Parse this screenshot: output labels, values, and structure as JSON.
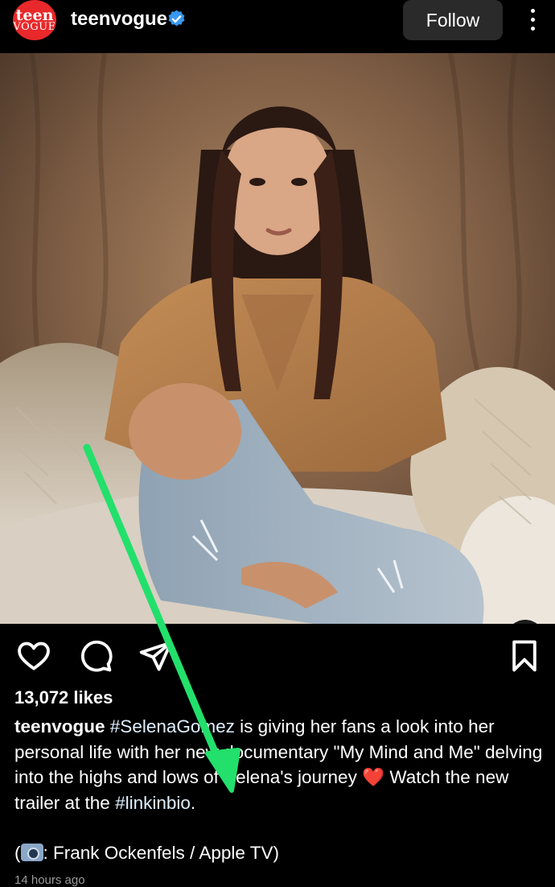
{
  "header": {
    "avatar_line1": "teen",
    "avatar_line2": "VOGUE",
    "username": "teenvogue",
    "follow_label": "Follow"
  },
  "post": {
    "likes_text": "13,072 likes",
    "caption_user": "teenvogue",
    "caption_hashtag": "#SelenaGomez",
    "caption_body": " is giving her fans a look into her personal life with her new documentary \"My Mind and Me\" delving into the highs and lows of Selena's journey ",
    "caption_heart": "❤️",
    "caption_after": " Watch the new trailer at the ",
    "caption_link_tag": "#linkinbio",
    "caption_end": ".",
    "credit_open": "(",
    "credit_text": ": Frank Ockenfels / Apple TV)",
    "timestamp": "14 hours ago"
  },
  "icons": {
    "verified": "verified-badge-icon",
    "more": "more-options-icon",
    "like": "heart-icon",
    "comment": "comment-icon",
    "share": "share-icon",
    "save": "bookmark-icon",
    "lens": "visual-search-icon"
  },
  "colors": {
    "background": "#000000",
    "verified_blue": "#3897f0",
    "avatar_red": "#e8282a",
    "annotation_arrow": "#22e06b"
  }
}
